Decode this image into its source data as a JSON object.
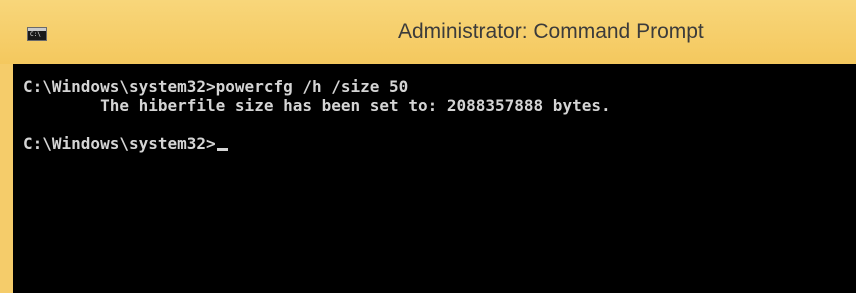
{
  "window": {
    "title": "Administrator: Command Prompt",
    "icon": "console-icon"
  },
  "console": {
    "lines": [
      "C:\\Windows\\system32>powercfg /h /size 50",
      "        The hiberfile size has been set to: 2088357888 bytes.",
      "",
      "C:\\Windows\\system32>"
    ],
    "cursor": "_"
  },
  "colors": {
    "titlebar": "#f4c85e",
    "console_background": "#000000",
    "console_text": "#d4d4d4"
  }
}
